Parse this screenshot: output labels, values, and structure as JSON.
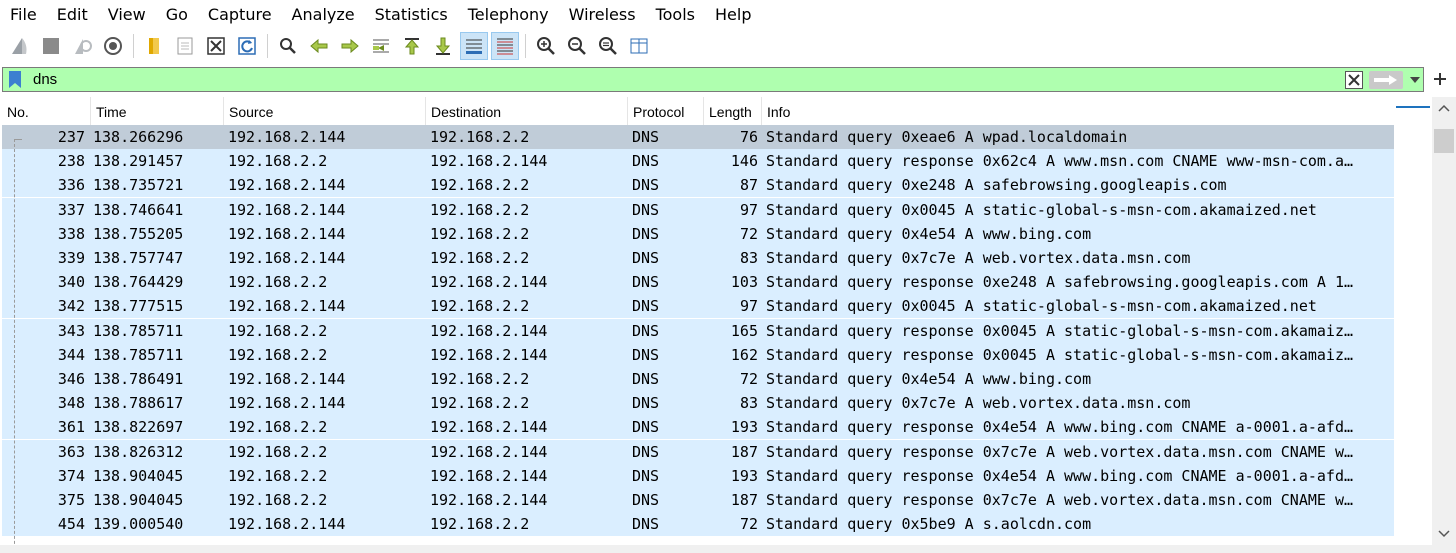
{
  "menu": [
    "File",
    "Edit",
    "View",
    "Go",
    "Capture",
    "Analyze",
    "Statistics",
    "Telephony",
    "Wireless",
    "Tools",
    "Help"
  ],
  "toolbar": {
    "icons": [
      "shark-fin-start-icon",
      "stop-capture-icon",
      "restart-capture-icon",
      "capture-options-icon",
      "open-file-icon",
      "save-file-icon",
      "close-file-icon",
      "reload-file-icon",
      "find-packet-icon",
      "go-back-icon",
      "go-forward-icon",
      "go-to-packet-icon",
      "first-packet-icon",
      "last-packet-icon",
      "autoscroll-icon",
      "colorize-icon",
      "zoom-in-icon",
      "zoom-out-icon",
      "zoom-normal-icon",
      "resize-columns-icon"
    ]
  },
  "filter": {
    "value": "dns",
    "bg_color": "#afffaf"
  },
  "columns": [
    "No.",
    "Time",
    "Source",
    "Destination",
    "Protocol",
    "Length",
    "Info"
  ],
  "colors": {
    "row_bg": "#daeeff",
    "selected_bg": "#c0ccd8",
    "accent": "#1e73be"
  },
  "packets": [
    {
      "no": "237",
      "time": "138.266296",
      "src": "192.168.2.144",
      "dst": "192.168.2.2",
      "proto": "DNS",
      "len": "76",
      "info": "Standard query 0xeae6 A wpad.localdomain"
    },
    {
      "no": "238",
      "time": "138.291457",
      "src": "192.168.2.2",
      "dst": "192.168.2.144",
      "proto": "DNS",
      "len": "146",
      "info": "Standard query response 0x62c4 A www.msn.com CNAME www-msn-com.a…"
    },
    {
      "no": "336",
      "time": "138.735721",
      "src": "192.168.2.144",
      "dst": "192.168.2.2",
      "proto": "DNS",
      "len": "87",
      "info": "Standard query 0xe248 A safebrowsing.googleapis.com"
    },
    {
      "no": "337",
      "time": "138.746641",
      "src": "192.168.2.144",
      "dst": "192.168.2.2",
      "proto": "DNS",
      "len": "97",
      "info": "Standard query 0x0045 A static-global-s-msn-com.akamaized.net"
    },
    {
      "no": "338",
      "time": "138.755205",
      "src": "192.168.2.144",
      "dst": "192.168.2.2",
      "proto": "DNS",
      "len": "72",
      "info": "Standard query 0x4e54 A www.bing.com"
    },
    {
      "no": "339",
      "time": "138.757747",
      "src": "192.168.2.144",
      "dst": "192.168.2.2",
      "proto": "DNS",
      "len": "83",
      "info": "Standard query 0x7c7e A web.vortex.data.msn.com"
    },
    {
      "no": "340",
      "time": "138.764429",
      "src": "192.168.2.2",
      "dst": "192.168.2.144",
      "proto": "DNS",
      "len": "103",
      "info": "Standard query response 0xe248 A safebrowsing.googleapis.com A 1…"
    },
    {
      "no": "342",
      "time": "138.777515",
      "src": "192.168.2.144",
      "dst": "192.168.2.2",
      "proto": "DNS",
      "len": "97",
      "info": "Standard query 0x0045 A static-global-s-msn-com.akamaized.net"
    },
    {
      "no": "343",
      "time": "138.785711",
      "src": "192.168.2.2",
      "dst": "192.168.2.144",
      "proto": "DNS",
      "len": "165",
      "info": "Standard query response 0x0045 A static-global-s-msn-com.akamaiz…"
    },
    {
      "no": "344",
      "time": "138.785711",
      "src": "192.168.2.2",
      "dst": "192.168.2.144",
      "proto": "DNS",
      "len": "162",
      "info": "Standard query response 0x0045 A static-global-s-msn-com.akamaiz…"
    },
    {
      "no": "346",
      "time": "138.786491",
      "src": "192.168.2.144",
      "dst": "192.168.2.2",
      "proto": "DNS",
      "len": "72",
      "info": "Standard query 0x4e54 A www.bing.com"
    },
    {
      "no": "348",
      "time": "138.788617",
      "src": "192.168.2.144",
      "dst": "192.168.2.2",
      "proto": "DNS",
      "len": "83",
      "info": "Standard query 0x7c7e A web.vortex.data.msn.com"
    },
    {
      "no": "361",
      "time": "138.822697",
      "src": "192.168.2.2",
      "dst": "192.168.2.144",
      "proto": "DNS",
      "len": "193",
      "info": "Standard query response 0x4e54 A www.bing.com CNAME a-0001.a-afd…"
    },
    {
      "no": "363",
      "time": "138.826312",
      "src": "192.168.2.2",
      "dst": "192.168.2.144",
      "proto": "DNS",
      "len": "187",
      "info": "Standard query response 0x7c7e A web.vortex.data.msn.com CNAME w…"
    },
    {
      "no": "374",
      "time": "138.904045",
      "src": "192.168.2.2",
      "dst": "192.168.2.144",
      "proto": "DNS",
      "len": "193",
      "info": "Standard query response 0x4e54 A www.bing.com CNAME a-0001.a-afd…"
    },
    {
      "no": "375",
      "time": "138.904045",
      "src": "192.168.2.2",
      "dst": "192.168.2.144",
      "proto": "DNS",
      "len": "187",
      "info": "Standard query response 0x7c7e A web.vortex.data.msn.com CNAME w…"
    },
    {
      "no": "454",
      "time": "139.000540",
      "src": "192.168.2.144",
      "dst": "192.168.2.2",
      "proto": "DNS",
      "len": "72",
      "info": "Standard query 0x5be9 A s.aolcdn.com"
    }
  ]
}
